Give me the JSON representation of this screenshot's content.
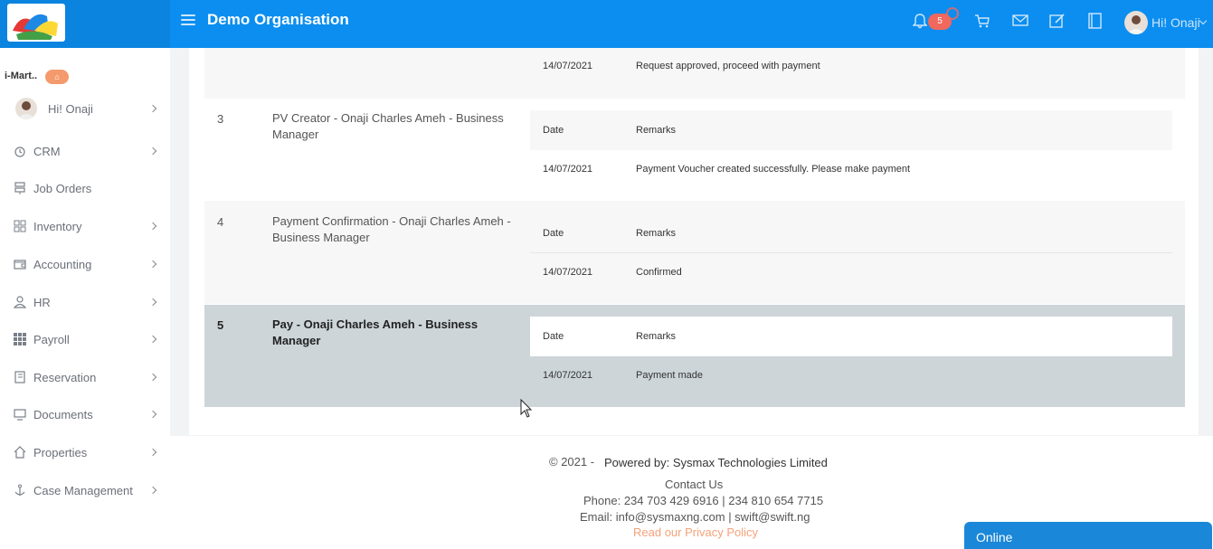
{
  "topbar": {
    "org_title": "Demo Organisation",
    "notification_count": "5",
    "user_label": "Hi! Onaji"
  },
  "sidebar": {
    "store_name": "i-Mart..",
    "items": [
      {
        "label": "Hi! Onaji",
        "icon": "user-avatar",
        "has_chevron": true
      },
      {
        "label": "CRM",
        "icon": "clock-icon",
        "has_chevron": true
      },
      {
        "label": "Job Orders",
        "icon": "server-icon",
        "has_chevron": false
      },
      {
        "label": "Inventory",
        "icon": "grid-icon",
        "has_chevron": true
      },
      {
        "label": "Accounting",
        "icon": "wallet-icon",
        "has_chevron": true
      },
      {
        "label": "HR",
        "icon": "person-icon",
        "has_chevron": true
      },
      {
        "label": "Payroll",
        "icon": "apps-icon",
        "has_chevron": true
      },
      {
        "label": "Reservation",
        "icon": "notebook-icon",
        "has_chevron": true
      },
      {
        "label": "Documents",
        "icon": "monitor-icon",
        "has_chevron": true
      },
      {
        "label": "Properties",
        "icon": "home-icon",
        "has_chevron": true
      },
      {
        "label": "Case Management",
        "icon": "anchor-icon",
        "has_chevron": true
      }
    ]
  },
  "approval_rows": [
    {
      "num": "",
      "stage": "",
      "date_header": "",
      "remarks_header": "",
      "date": "14/07/2021",
      "remark": "Request approved, proceed with payment"
    },
    {
      "num": "3",
      "stage": "PV Creator - Onaji Charles Ameh - Business Manager",
      "date_header": "Date",
      "remarks_header": "Remarks",
      "date": "14/07/2021",
      "remark": "Payment Voucher created successfully. Please make payment"
    },
    {
      "num": "4",
      "stage": "Payment Confirmation - Onaji Charles Ameh - Business Manager",
      "date_header": "Date",
      "remarks_header": "Remarks",
      "date": "14/07/2021",
      "remark": "Confirmed"
    },
    {
      "num": "5",
      "stage": "Pay - Onaji Charles Ameh - Business Manager",
      "date_header": "Date",
      "remarks_header": "Remarks",
      "date": "14/07/2021",
      "remark": "Payment made"
    }
  ],
  "footer": {
    "copyright": "© 2021 -",
    "powered_by": "Powered by: Sysmax Technologies Limited",
    "contact_title": "Contact Us",
    "phone": "Phone: 234 703 429 6916 | 234 810 654 7715",
    "email": "Email: info@sysmaxng.com | swift@swift.ng",
    "privacy_link": "Read our Privacy Policy"
  },
  "chat": {
    "status": "Online"
  },
  "colors": {
    "topbar": "#0b8ef0",
    "active_row": "#cdd5d9",
    "badge": "#f0685e",
    "chat": "#1a87d8"
  }
}
